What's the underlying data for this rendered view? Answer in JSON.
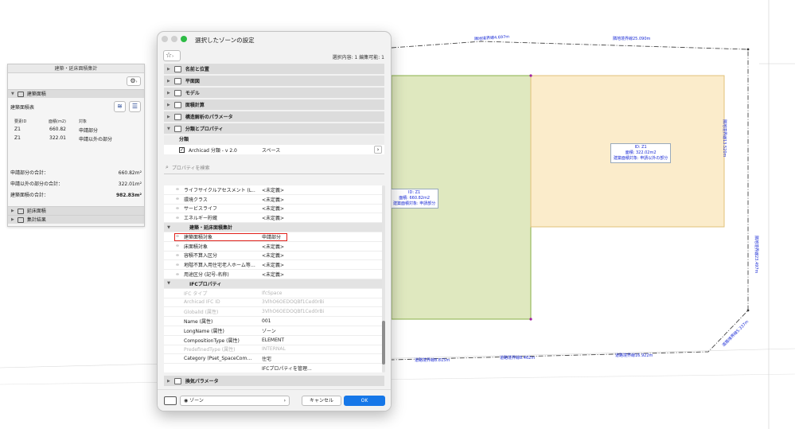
{
  "drawing": {
    "zones": [
      {
        "id": "ID: Z1",
        "area": "面積: 660.82m2",
        "target": "建築面積対象: 申請部分"
      },
      {
        "id": "ID: Z1",
        "area": "面積: 322.02m2",
        "target": "建築面積対象: 申請以外の部分"
      }
    ],
    "boundary_labels": [
      "隣地境界線4.697m",
      "隣地境界線25.090m",
      "隣地境界線13.520m",
      "隣地境界線23.497m",
      "道路境界線5.337m",
      "道路境界線8.815m",
      "道路境界線8.462m",
      "道路境界線16.922m"
    ],
    "colors": {
      "zone_green": "#dfe8bf",
      "zone_orange": "#fbeccb"
    }
  },
  "palette": {
    "title": "建築・延床面積集計",
    "section_building": "建築面積",
    "table_title": "建築面積表",
    "columns": [
      "要素ID",
      "面積(m2)",
      "対象"
    ],
    "rows": [
      [
        "Z1",
        "660.82",
        "申請部分"
      ],
      [
        "Z1",
        "322.01",
        "申請以外の部分"
      ]
    ],
    "totals": [
      {
        "label": "申請部分の合計：",
        "value": "660.82m²"
      },
      {
        "label": "申請以外の部分の合計：",
        "value": "322.01m²"
      },
      {
        "label": "建築面積の合計：",
        "value": "982.83m²"
      }
    ],
    "section_floor": "延床面積",
    "section_result": "集計結果"
  },
  "dialog": {
    "title": "選択したゾーンの設定",
    "selection_info": "選択内容: 1 編集可能: 1",
    "panels": [
      "名前と位置",
      "平面図",
      "モデル",
      "面積計算",
      "構造解析のパラメータ",
      "分類とプロパティ"
    ],
    "classification": {
      "header": "分類",
      "name": "Archicad 分類 - v 2.0",
      "value": "スペース"
    },
    "search_placeholder": "プロパティを検索",
    "props_top": [
      {
        "name": "ライフサイクルアセスメント (L…",
        "value": "<未定義>"
      },
      {
        "name": "環境クラス",
        "value": "<未定義>"
      },
      {
        "name": "サービスライフ",
        "value": "<未定義>"
      },
      {
        "name": "エネルギー貯蔵",
        "value": "<未定義>"
      }
    ],
    "group_area": "建築・延床面積集計",
    "props_area": [
      {
        "name": "建築面積対象",
        "value": "申請部分"
      },
      {
        "name": "床面積対象",
        "value": "<未定義>"
      },
      {
        "name": "容積不算入区分",
        "value": "<未定義>"
      },
      {
        "name": "地階不算入用住宅老人ホーム等…",
        "value": "<未定義>"
      },
      {
        "name": "用途区分 (記号-名称)",
        "value": "<未定義>"
      }
    ],
    "group_ifc": "IFCプロパティ",
    "props_ifc": [
      {
        "name": "IFC タイプ",
        "value": "IfcSpace"
      },
      {
        "name": "Archicad IFC ID",
        "value": "3VlhO6OEDOQBf1Ced0rBi"
      },
      {
        "name": "GlobalId (属性)",
        "value": "3VlhO6OEDOQBf1Ced0rBi"
      },
      {
        "name": "Name (属性)",
        "value": "001"
      },
      {
        "name": "LongName (属性)",
        "value": "ゾーン"
      },
      {
        "name": "CompositionType (属性)",
        "value": "ELEMENT"
      },
      {
        "name": "PredefinedType (属性)",
        "value": "INTERNAL"
      },
      {
        "name": "Category (Pset_SpaceCom…",
        "value": "住宅"
      },
      {
        "name": "",
        "value": "IFCプロパティを管理..."
      }
    ],
    "bottom_panel": "換気パラメータ",
    "footer": {
      "zone_label": "ゾーン",
      "cancel": "キャンセル",
      "ok": "OK"
    }
  }
}
